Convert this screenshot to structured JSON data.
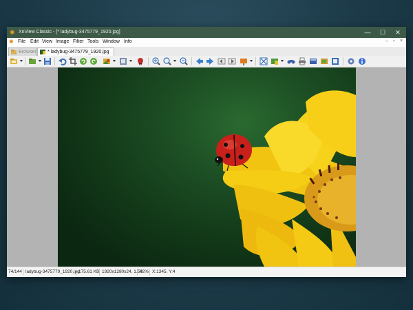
{
  "window": {
    "title": "XnView Classic - [* ladybug-3475779_1920.jpg]"
  },
  "window_controls": {
    "minimize": "—",
    "maximize": "☐",
    "close": "✕"
  },
  "menu": {
    "items": [
      {
        "label": "File"
      },
      {
        "label": "Edit"
      },
      {
        "label": "View"
      },
      {
        "label": "Image"
      },
      {
        "label": "Filter"
      },
      {
        "label": "Tools"
      },
      {
        "label": "Window"
      },
      {
        "label": "Info"
      }
    ],
    "mdi_controls": {
      "minimize": "–",
      "restore": "▫",
      "close": "×"
    }
  },
  "tabs": [
    {
      "label": "Browser",
      "icon": "browser-icon",
      "active": false
    },
    {
      "label": "* ladybug-3475779_1920.jpg",
      "icon": "image-icon",
      "active": true
    }
  ],
  "toolbar": {
    "icons": [
      "browser-icon",
      "open-folder-icon",
      "save-icon",
      "undo-icon",
      "crop-icon",
      "rotate-left-icon",
      "rotate-right-icon",
      "adjust-icon",
      "resize-icon",
      "effects-icon",
      "zoom-in-icon",
      "zoom-fit-icon",
      "zoom-out-icon",
      "previous-icon",
      "next-icon",
      "first-page-icon",
      "last-page-icon",
      "slideshow-icon",
      "fullscreen-icon",
      "capture-icon",
      "binoculars-icon",
      "print-icon",
      "scanner-icon",
      "convert-icon",
      "screenshot-icon",
      "settings-icon",
      "info-icon"
    ]
  },
  "image": {
    "subject": "ladybug on yellow flower",
    "colors": {
      "background": "#1d4f24",
      "petal": "#f7d21a",
      "center": "#e0a020",
      "ladybug": "#c8201a"
    }
  },
  "statusbar": {
    "position": "74/144",
    "filename": "ladybug-3475779_1920.jpg",
    "filesize": "175.61 KB",
    "dimensions": "1920x1280x24, 1.50",
    "zoom": "42%",
    "cursor": "X:1345, Y:4"
  },
  "colors": {
    "titlebar": "#3d5a48",
    "desktop": "#1c3a48",
    "viewer_bg": "#b3b3b3"
  }
}
